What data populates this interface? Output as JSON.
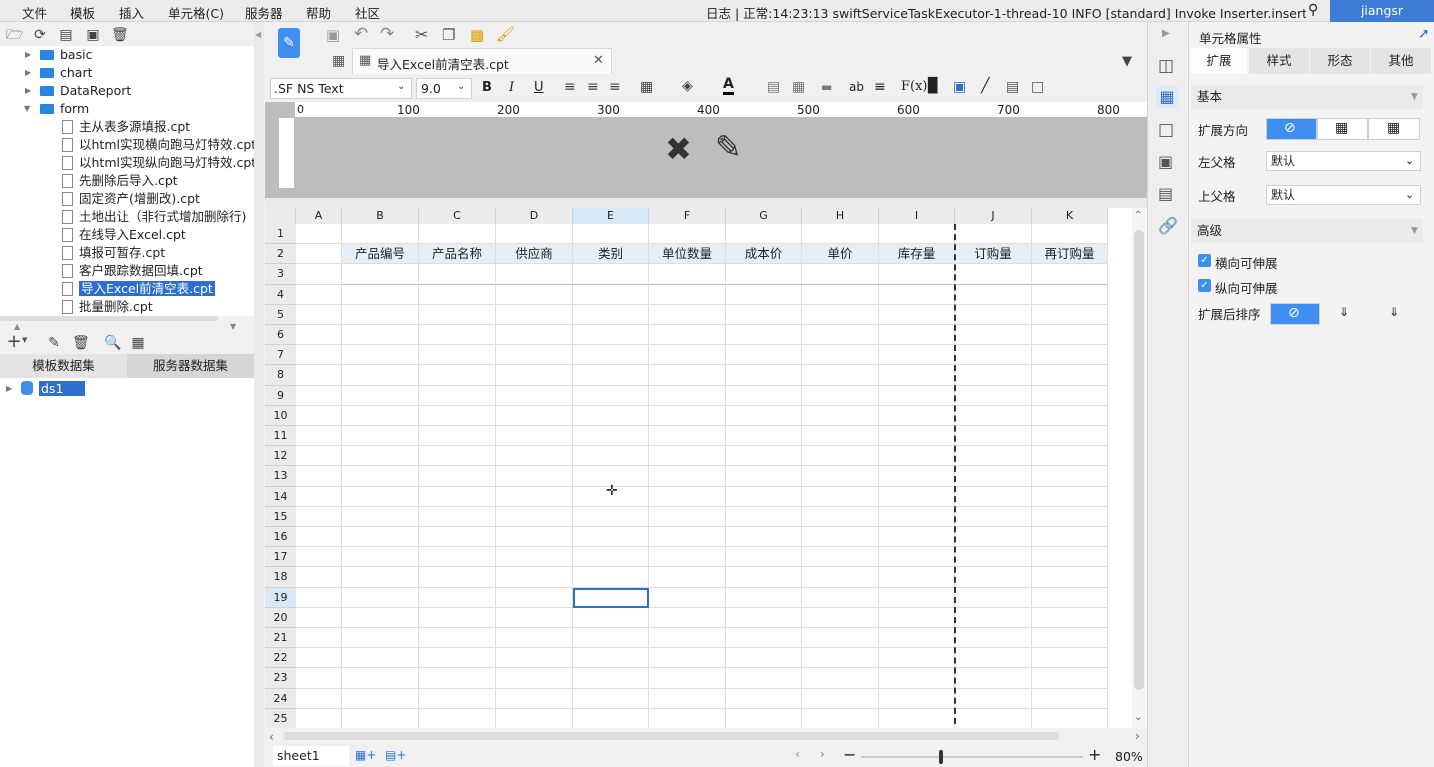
{
  "menubar": {
    "items": [
      "文件",
      "模板",
      "插入",
      "单元格(C)",
      "服务器",
      "帮助",
      "社区"
    ],
    "log": "日志 | 正常:14:23:13 swiftServiceTaskExecutor-1-thread-10 INFO [standard] Invoke Inserter.insertDa...",
    "user": "jiangsr"
  },
  "tree": {
    "folders": [
      "basic",
      "chart",
      "DataReport",
      "form"
    ],
    "files": [
      "主从表多源填报.cpt",
      "以html实现横向跑马灯特效.cpt",
      "以html实现纵向跑马灯特效.cpt",
      "先删除后导入.cpt",
      "固定资产(增删改).cpt",
      "土地出让（非行式增加删除行)",
      "在线导入Excel.cpt",
      "填报可暂存.cpt",
      "客户跟踪数据回填.cpt",
      "导入Excel前清空表.cpt",
      "批量删除.cpt"
    ]
  },
  "datasets": {
    "tabs": [
      "模板数据集",
      "服务器数据集"
    ],
    "items": [
      "ds1"
    ]
  },
  "editor": {
    "tab_title": "导入Excel前清空表.cpt",
    "font_name": ".SF NS Text",
    "font_size": "9.0",
    "ruler_ticks": [
      "0",
      "100",
      "200",
      "300",
      "400",
      "500",
      "600",
      "700",
      "800"
    ],
    "columns": [
      "A",
      "B",
      "C",
      "D",
      "E",
      "F",
      "G",
      "H",
      "I",
      "J",
      "K"
    ],
    "rows": [
      "1",
      "2",
      "3",
      "4",
      "5",
      "6",
      "7",
      "8",
      "9",
      "10",
      "11",
      "12",
      "13",
      "14",
      "15",
      "16",
      "17",
      "18",
      "19",
      "20",
      "21",
      "22",
      "23",
      "24",
      "25"
    ],
    "headers": [
      "产品编号",
      "产品名称",
      "供应商",
      "类别",
      "单位数量",
      "成本价",
      "单价",
      "库存量",
      "订购量",
      "再订购量"
    ],
    "sheet": "sheet1",
    "zoom": "80%",
    "selected_cell": "E19"
  },
  "props": {
    "title": "单元格属性",
    "tabs": [
      "扩展",
      "样式",
      "形态",
      "其他"
    ],
    "basic_section": "基本",
    "expand_dir_label": "扩展方向",
    "left_parent_label": "左父格",
    "left_parent_value": "默认",
    "top_parent_label": "上父格",
    "top_parent_value": "默认",
    "advanced_section": "高级",
    "h_expand_label": "横向可伸展",
    "v_expand_label": "纵向可伸展",
    "sort_label": "扩展后排序"
  },
  "colors": {
    "accent": "#3e8ff0",
    "selection": "#2c6fd1",
    "user_bg": "#3e7bd6"
  }
}
